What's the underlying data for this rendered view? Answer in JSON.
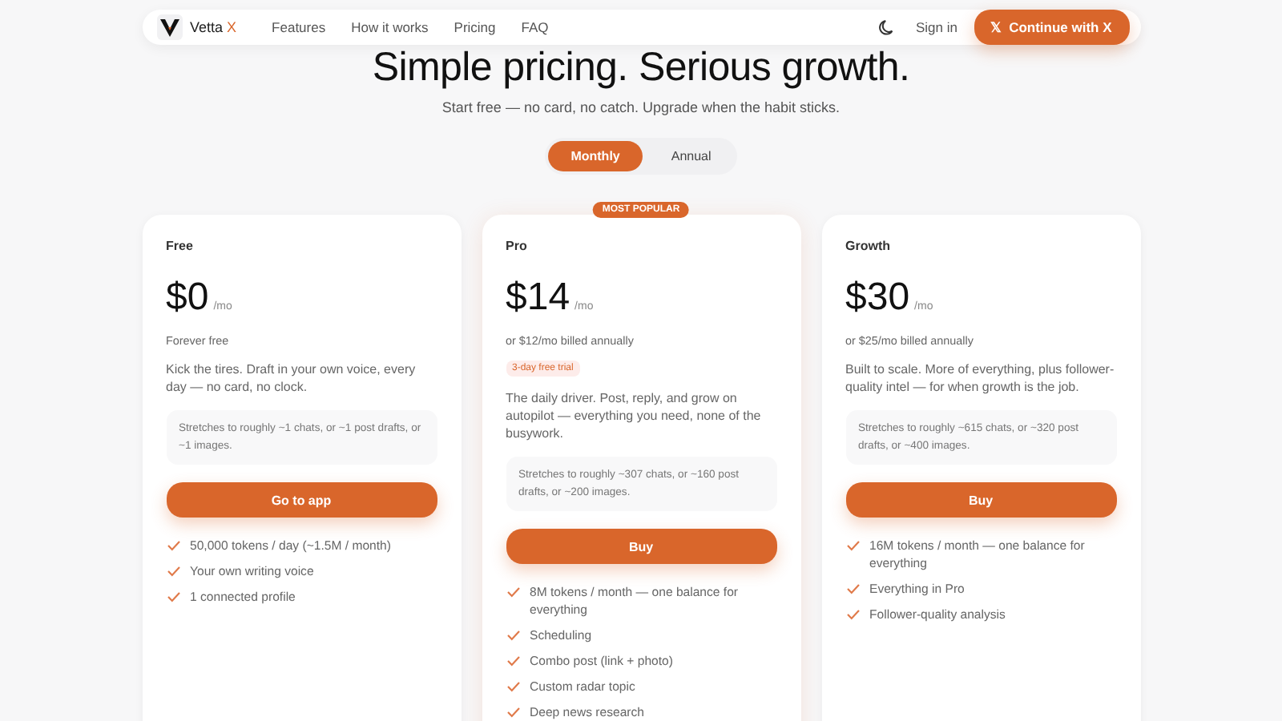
{
  "nav": {
    "brand": "Vetta",
    "brand_accent": "X",
    "links": [
      "Features",
      "How it works",
      "Pricing",
      "FAQ"
    ],
    "signin": "Sign in",
    "cta_icon": "𝕏",
    "cta": "Continue with X"
  },
  "hero": {
    "title": "Simple pricing. Serious growth.",
    "subtitle": "Start free — no card, no catch. Upgrade when the habit sticks."
  },
  "billing_tabs": [
    {
      "label": "Monthly",
      "selected": true
    },
    {
      "label": "Annual",
      "selected": false
    }
  ],
  "plans": [
    {
      "name": "Free",
      "price": "$0",
      "period": "/mo",
      "note": "Forever free",
      "description": "Kick the tires. Draft in your own voice, every day — no card, no clock.",
      "stretch": "Stretches to roughly ~1 chats, or ~1 post drafts, or ~1 images.",
      "button": "Go to app",
      "features": [
        "50,000 tokens / day (~1.5M / month)",
        "Your own writing voice",
        "1 connected profile"
      ]
    },
    {
      "name": "Pro",
      "badge": "MOST POPULAR",
      "price": "$14",
      "period": "/mo",
      "note": "or $12/mo billed annually",
      "trial": "3-day free trial",
      "description": "The daily driver. Post, reply, and grow on autopilot — everything you need, none of the busywork.",
      "stretch": "Stretches to roughly ~307 chats, or ~160 post drafts, or ~200 images.",
      "button": "Buy",
      "features": [
        "8M tokens / month — one balance for everything",
        "Scheduling",
        "Combo post (link + photo)",
        "Custom radar topic",
        "Deep news research"
      ]
    },
    {
      "name": "Growth",
      "price": "$30",
      "period": "/mo",
      "note": "or $25/mo billed annually",
      "description": "Built to scale. More of everything, plus follower-quality intel — for when growth is the job.",
      "stretch": "Stretches to roughly ~615 chats, or ~320 post drafts, or ~400 images.",
      "button": "Buy",
      "features": [
        "16M tokens / month — one balance for everything",
        "Everything in Pro",
        "Follower-quality analysis"
      ]
    }
  ]
}
